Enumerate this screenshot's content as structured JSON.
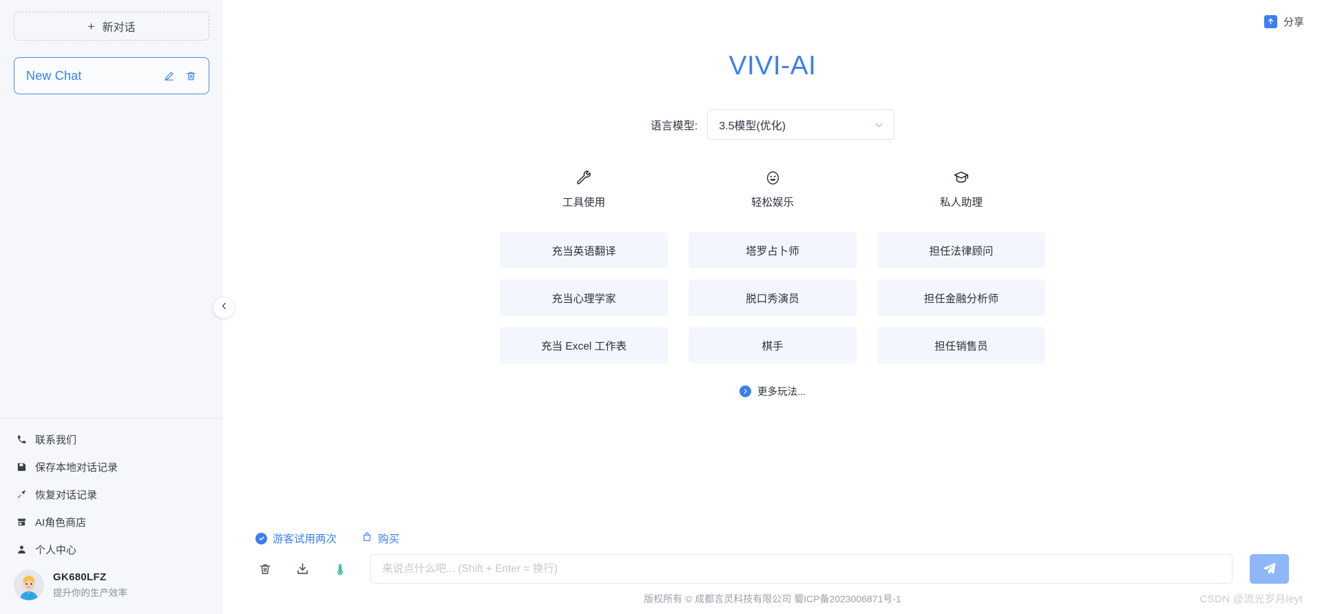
{
  "sidebar": {
    "new_chat_label": "新对话",
    "new_chat_plus": "+",
    "chat_items": [
      {
        "title": "New Chat",
        "edit_icon": "pencil-icon",
        "delete_icon": "trash-icon"
      }
    ],
    "menu": [
      {
        "label": "联系我们",
        "icon": "phone-icon"
      },
      {
        "label": "保存本地对话记录",
        "icon": "save-icon"
      },
      {
        "label": "恢复对话记录",
        "icon": "restore-arrow-icon"
      },
      {
        "label": "AI角色商店",
        "icon": "store-icon"
      },
      {
        "label": "个人中心",
        "icon": "user-icon"
      }
    ],
    "user": {
      "name": "GK680LFZ",
      "subtitle": "提升你的生产效率",
      "avatar": "user-avatar"
    },
    "collapse_icon": "chevron-left-icon"
  },
  "header": {
    "share_label": "分享",
    "share_icon": "share-icon"
  },
  "main": {
    "brand_title": "VIVI-AI",
    "model_label": "语言模型:",
    "model_value": "3.5模型(优化)",
    "model_chevron": "chevron-down-icon",
    "categories": [
      {
        "label": "工具使用",
        "icon": "wrench-icon"
      },
      {
        "label": "轻松娱乐",
        "icon": "smiley-face-icon"
      },
      {
        "label": "私人助理",
        "icon": "graduation-cap-icon"
      }
    ],
    "cards": [
      "充当英语翻译",
      "塔罗占卜师",
      "担任法律顾问",
      "充当心理学家",
      "脱口秀演员",
      "担任金融分析师",
      "充当 Excel 工作表",
      "棋手",
      "担任销售员"
    ],
    "more_label": "更多玩法...",
    "more_icon": "chevron-right-circle-icon"
  },
  "composer": {
    "trial_label": "游客试用两次",
    "trial_icon": "check-circle-icon",
    "buy_label": "购买",
    "buy_icon": "shopping-bag-icon",
    "tools": [
      {
        "name": "clear-icon"
      },
      {
        "name": "download-icon"
      },
      {
        "name": "temperature-icon"
      }
    ],
    "input_placeholder": "来说点什么吧... (Shift + Enter = 换行)",
    "input_value": "",
    "send_icon": "send-plane-icon"
  },
  "footer": {
    "copyright": "版权所有 © 成都言灵科技有限公司 蜀ICP备2023006871号-1",
    "watermark": "CSDN @流光岁月leyt"
  },
  "colors": {
    "accent": "#3b7ef6",
    "sidebar_bg": "#f5f7fa",
    "card_bg": "#f3f7fd",
    "send_btn": "#8fb7f8"
  }
}
